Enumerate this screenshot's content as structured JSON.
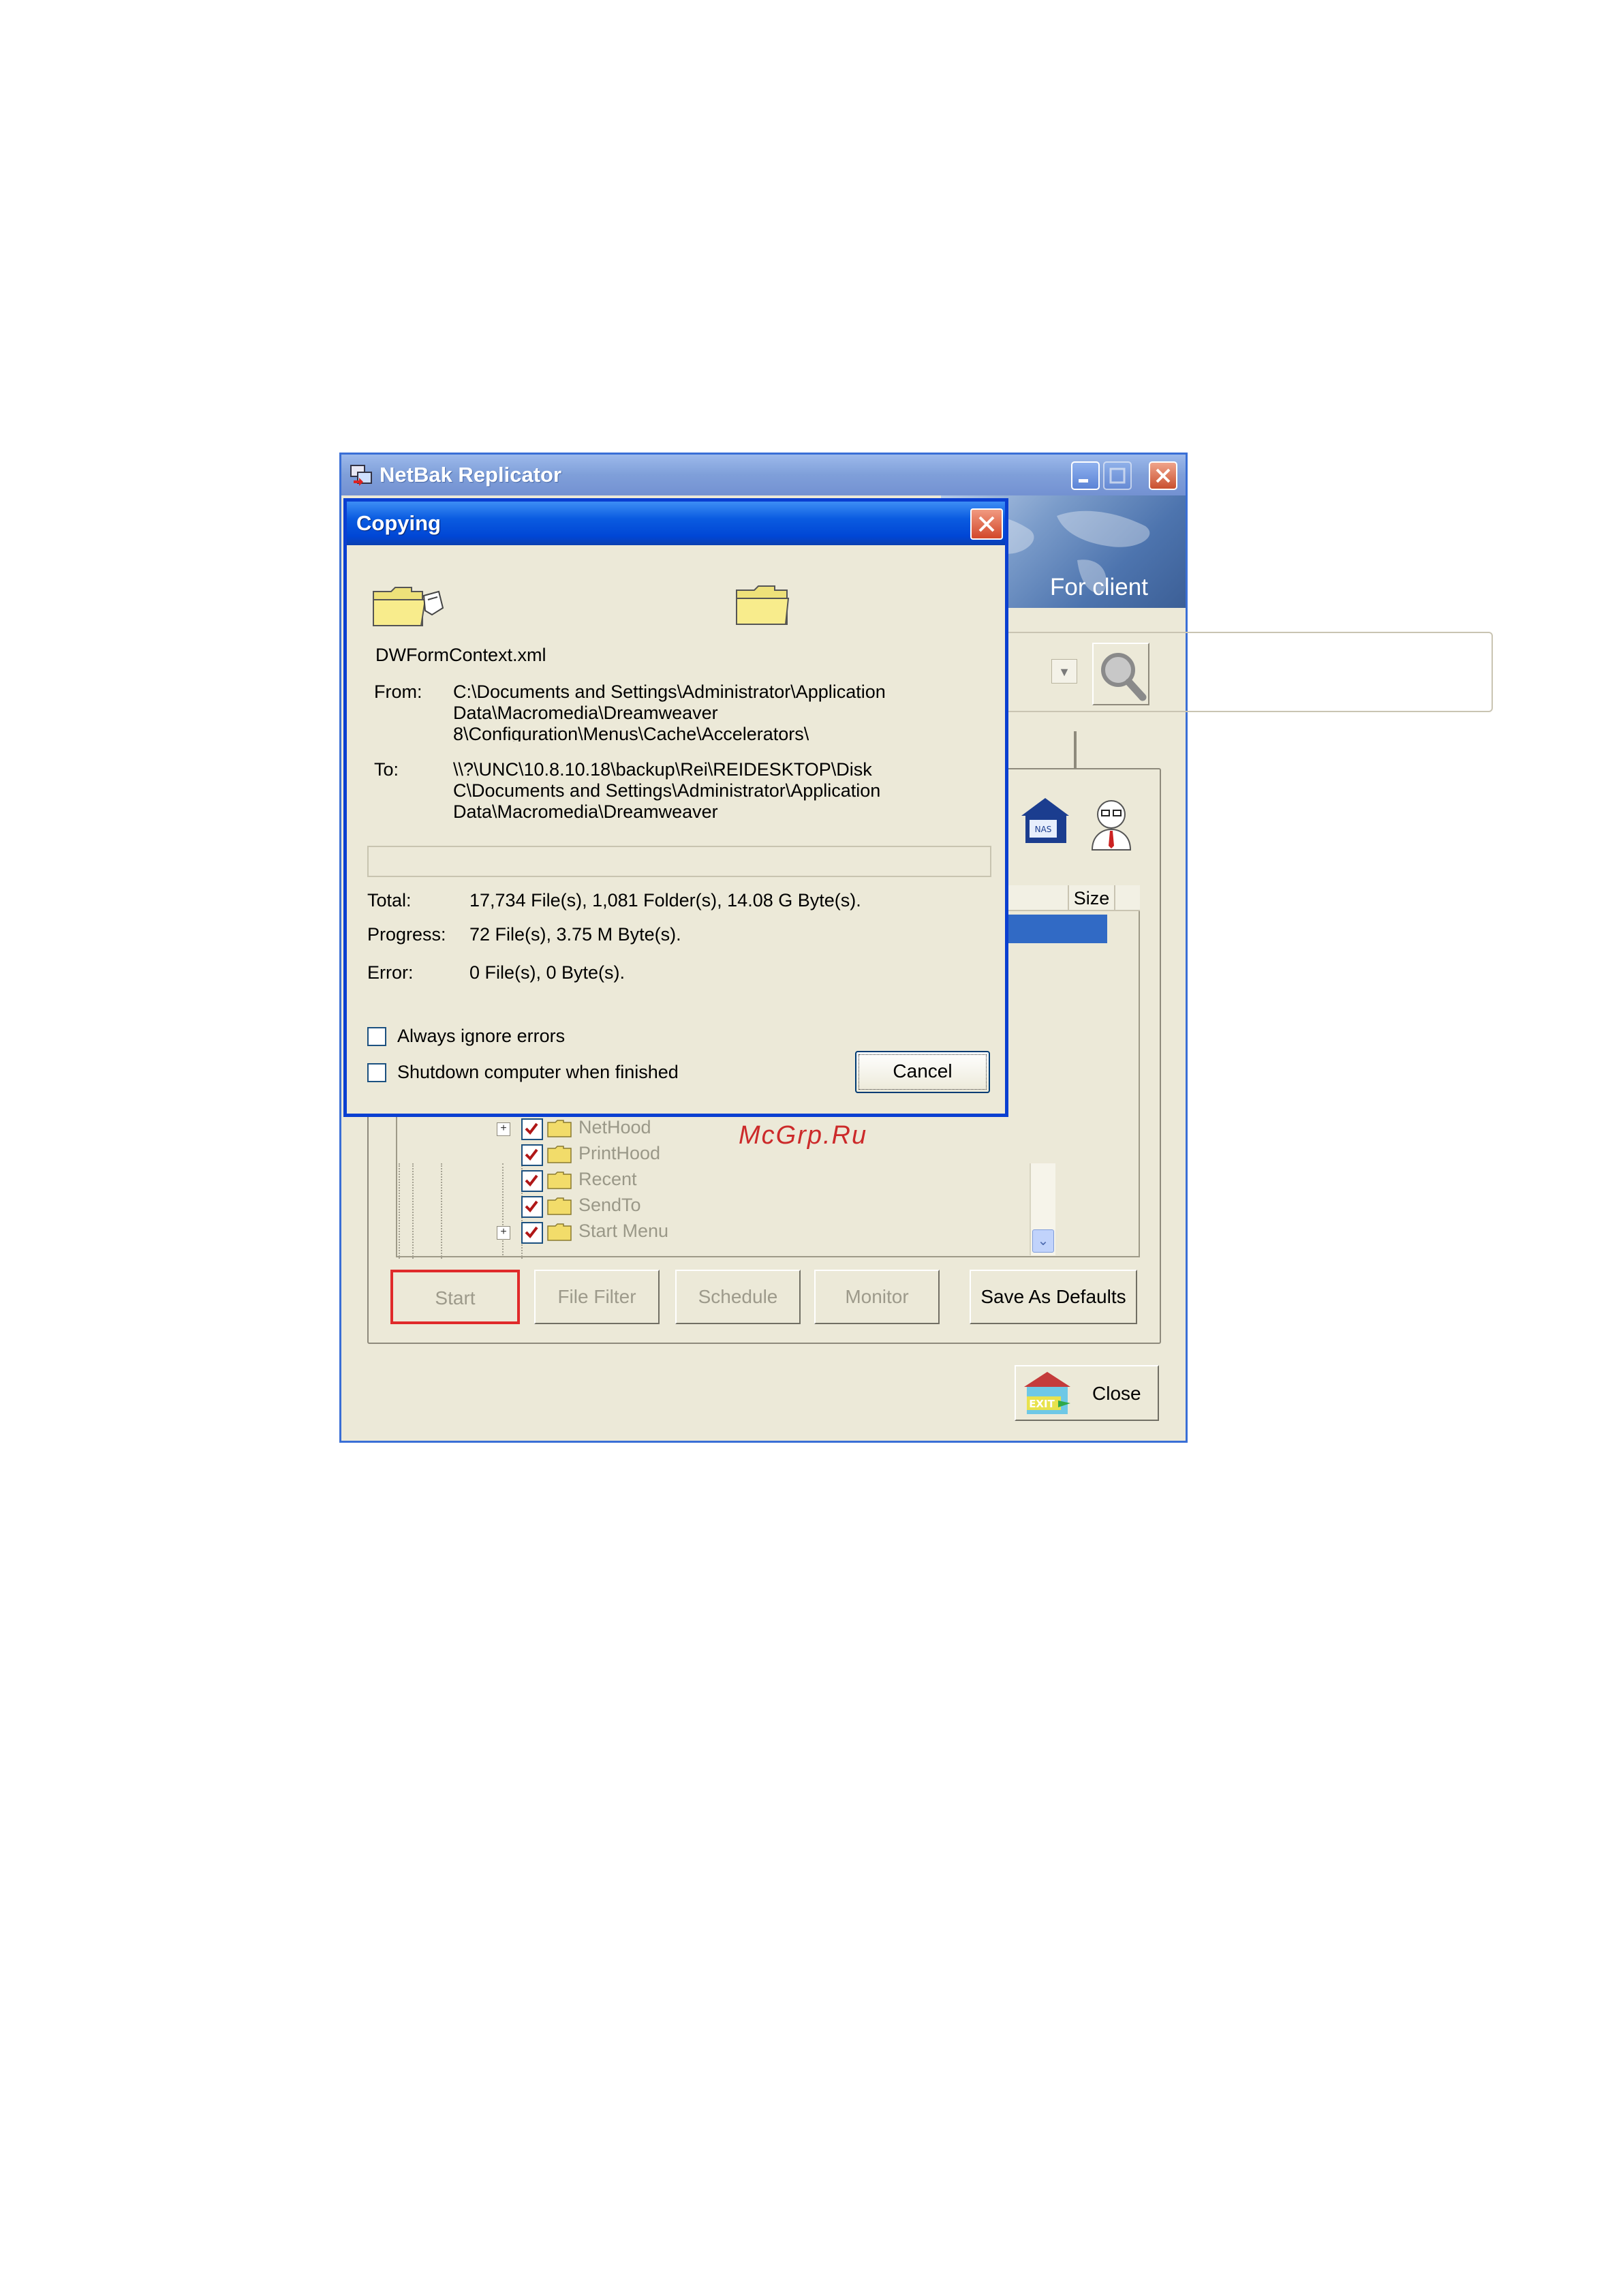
{
  "main_window": {
    "title": "NetBak Replicator",
    "banner_text": "For client",
    "list": {
      "columns": [
        "Size"
      ]
    },
    "tree_items": [
      {
        "label": "NetHood",
        "checked": true,
        "expandable": true
      },
      {
        "label": "PrintHood",
        "checked": true,
        "expandable": false
      },
      {
        "label": "Recent",
        "checked": true,
        "expandable": false
      },
      {
        "label": "SendTo",
        "checked": true,
        "expandable": false
      },
      {
        "label": "Start Menu",
        "checked": true,
        "expandable": true
      }
    ],
    "buttons": {
      "start": "Start",
      "file_filter": "File Filter",
      "schedule": "Schedule",
      "monitor": "Monitor",
      "save_defaults": "Save As Defaults",
      "close": "Close"
    },
    "icons": {
      "app": "netbak-app-icon",
      "search": "magnifier-icon",
      "nas": "nas-icon",
      "admin": "admin-user-icon",
      "exit": "exit-icon"
    }
  },
  "watermark": "McGrp.Ru",
  "dialog": {
    "title": "Copying",
    "file_name": "DWFormContext.xml",
    "from_label": "From:",
    "from_lines": [
      "C:\\Documents and Settings\\Administrator\\Application",
      "Data\\Macromedia\\Dreamweaver",
      "8\\Configuration\\Menus\\Cache\\Accelerators\\"
    ],
    "to_label": "To:",
    "to_lines": [
      "\\\\?\\UNC\\10.8.10.18\\backup\\Rei\\REIDESKTOP\\Disk",
      "C\\Documents and Settings\\Administrator\\Application",
      "Data\\Macromedia\\Dreamweaver"
    ],
    "progress_fraction": 0.0,
    "total_label": "Total:",
    "total_value": "17,734 File(s), 1,081 Folder(s), 14.08 G Byte(s).",
    "progress_label": "Progress:",
    "progress_value": "72 File(s), 3.75 M Byte(s).",
    "error_label": "Error:",
    "error_value": "0 File(s), 0 Byte(s).",
    "always_ignore_label": "Always ignore errors",
    "always_ignore_checked": false,
    "shutdown_label": "Shutdown computer when finished",
    "shutdown_checked": false,
    "cancel_label": "Cancel"
  },
  "colors": {
    "dialog_border": "#0a3fd1",
    "selection": "#316ac5",
    "start_highlight": "#e02a2a",
    "window_face": "#ece9d8"
  }
}
